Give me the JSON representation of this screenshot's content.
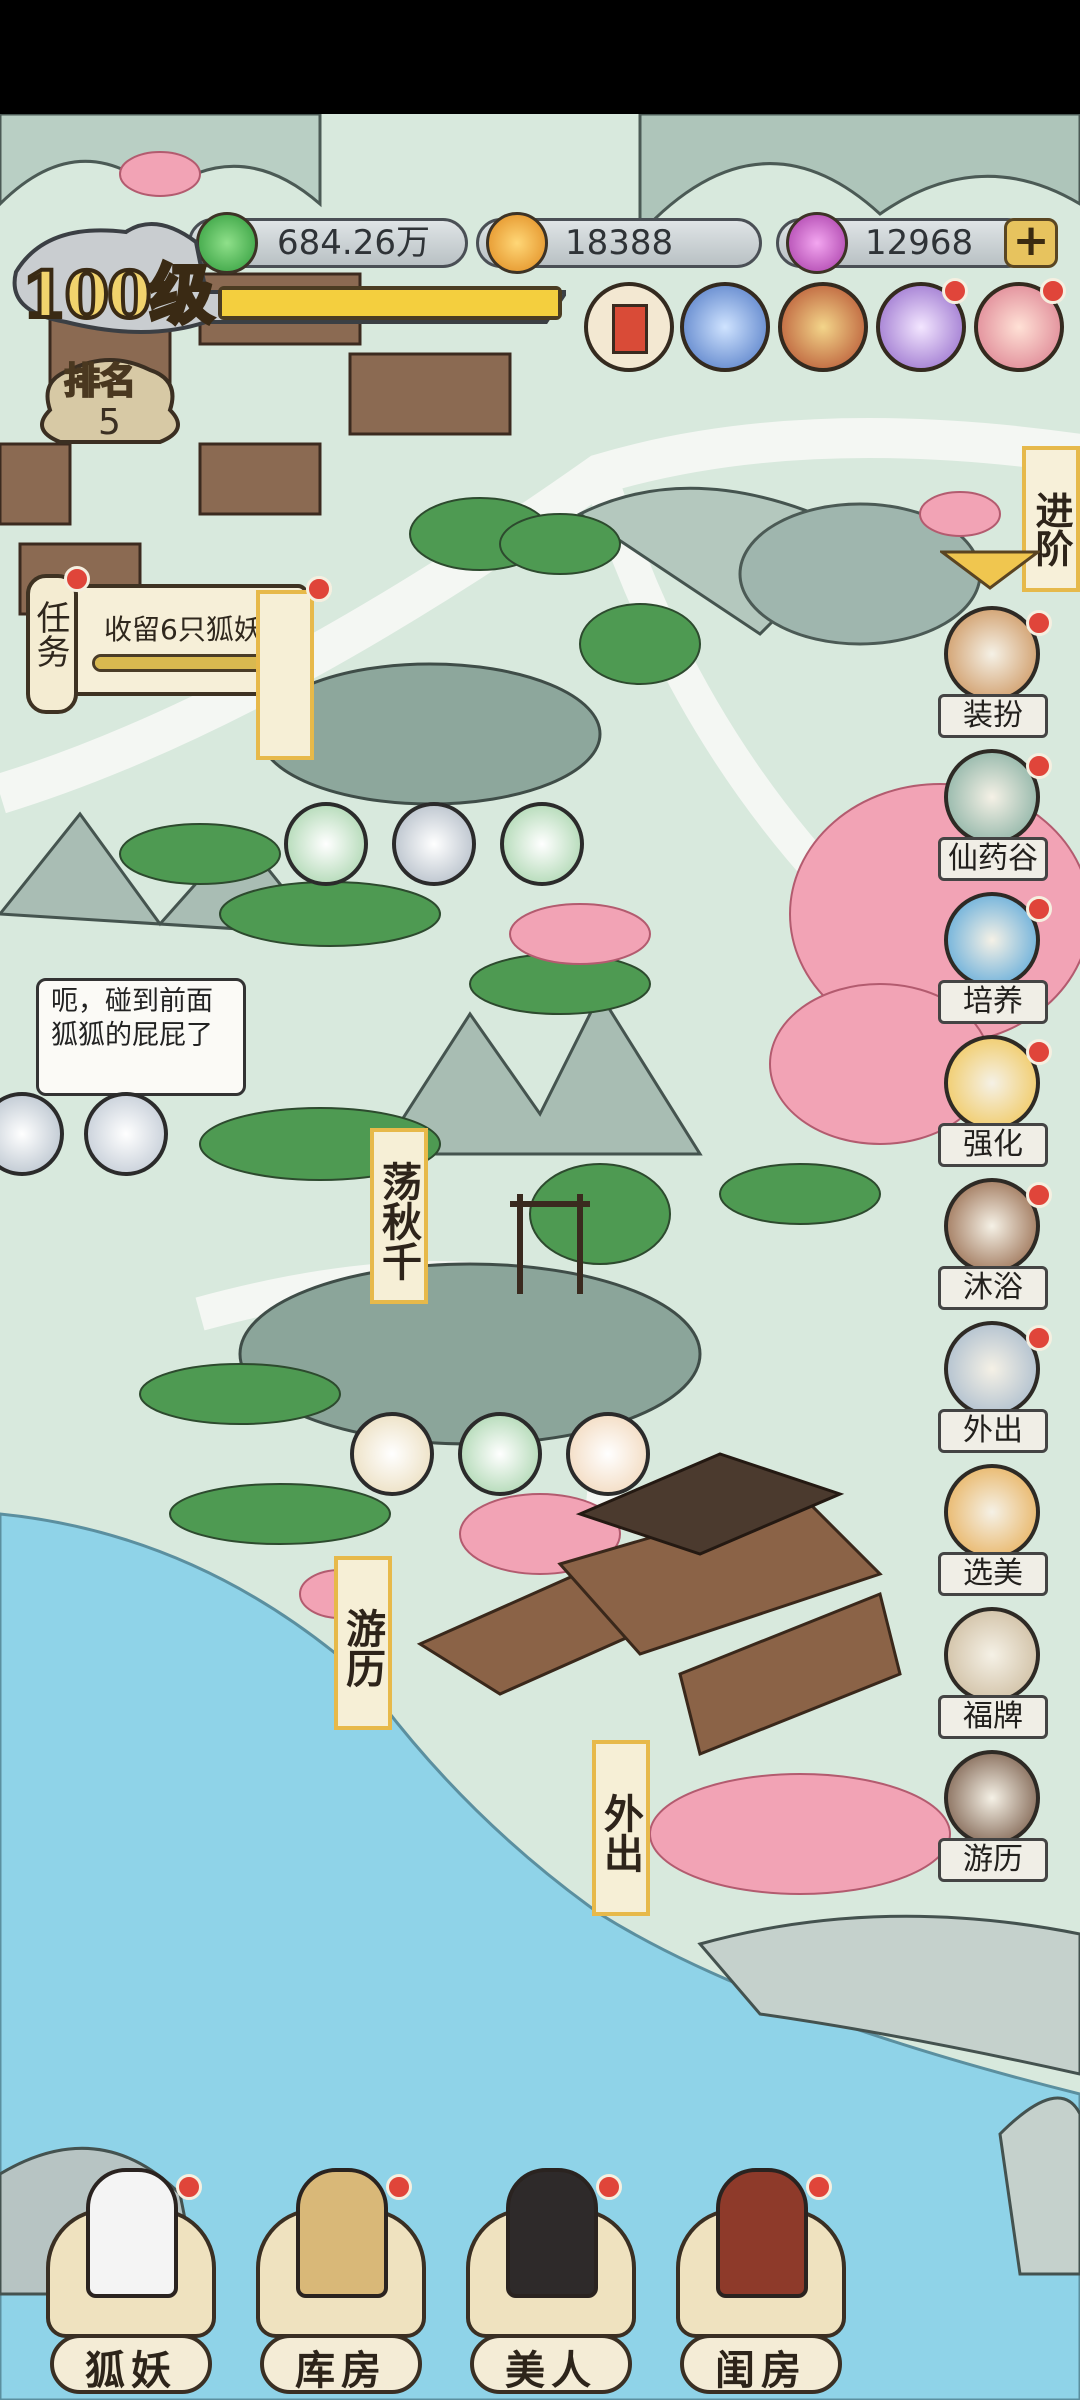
{
  "hud": {
    "currencies": [
      {
        "name": "jade-flame",
        "value": "684.26万",
        "color": "#3fb24a"
      },
      {
        "name": "gold-coin",
        "value": "18388",
        "color": "#f0a726"
      },
      {
        "name": "purple-gem",
        "value": "12968",
        "color": "#c54fc5"
      }
    ],
    "plus_label": "+",
    "level_text": "100级",
    "xp_progress": 1.0,
    "rank_label": "排名",
    "rank_value": "5"
  },
  "top_icons": [
    "scroll-icon",
    "gear-icon",
    "treasure-box-icon",
    "purple-orb-icon",
    "fox-flower-icon"
  ],
  "task": {
    "side_label": "任务",
    "text": "收留6只狐妖",
    "progress": 0.9
  },
  "advance_label": "进阶",
  "side_menu": [
    {
      "label": "装扮",
      "icon": "mirror-icon"
    },
    {
      "label": "仙药谷",
      "icon": "mountain-icon"
    },
    {
      "label": "培养",
      "icon": "blue-swirl-icon"
    },
    {
      "label": "强化",
      "icon": "flame-icon"
    },
    {
      "label": "沐浴",
      "icon": "bath-tub-icon"
    },
    {
      "label": "外出",
      "icon": "cloud-peak-icon"
    },
    {
      "label": "选美",
      "icon": "gold-fox-icon"
    },
    {
      "label": "福牌",
      "icon": "lucky-plate-icon"
    },
    {
      "label": "游历",
      "icon": "boat-icon"
    }
  ],
  "speech": "呃，碰到前面狐狐的屁屁了",
  "map_labels": {
    "swing": "荡秋千",
    "travel": "游历",
    "outing": "外出"
  },
  "bottom_nav": [
    {
      "label": "狐妖",
      "icon": "white-fox-icon"
    },
    {
      "label": "库房",
      "icon": "treasure-bag-icon"
    },
    {
      "label": "美人",
      "icon": "beauty-icon"
    },
    {
      "label": "闺房",
      "icon": "boudoir-icon"
    }
  ],
  "colors": {
    "sea": "#8fd3e8",
    "land": "#d6e8dc",
    "blossom": "#f2a3b5",
    "accent_gold": "#e7b94a"
  }
}
